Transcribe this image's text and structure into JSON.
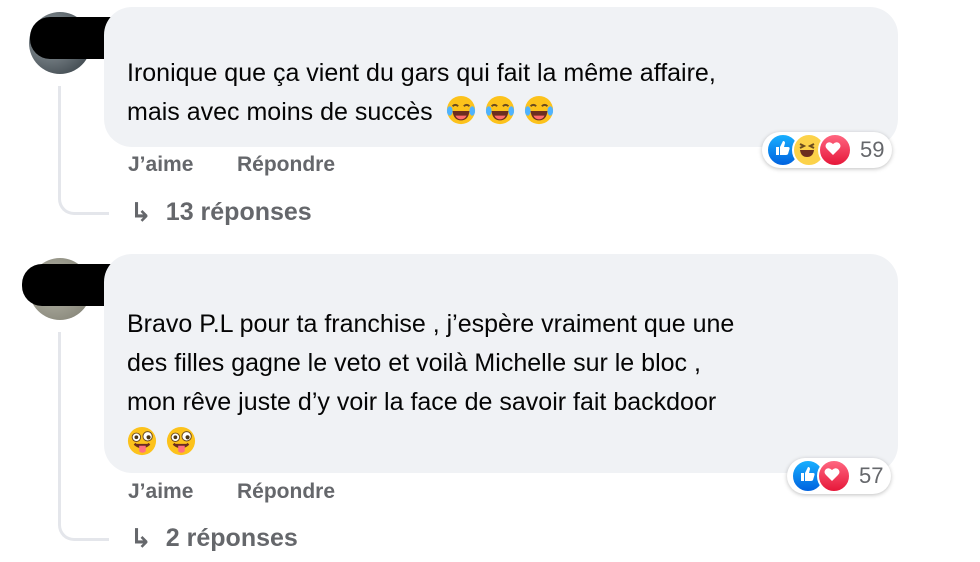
{
  "comments": [
    {
      "text_lines": [
        "Ironique que ça vient du gars qui fait la même affaire,",
        "mais avec moins de succès"
      ],
      "emojis": [
        "laughing-tears",
        "laughing-tears",
        "laughing-tears"
      ],
      "like_label": "J’aime",
      "reply_label": "Répondre",
      "replies_label": "13 réponses",
      "reaction_count": "59",
      "reactions": [
        "like",
        "haha",
        "love"
      ]
    },
    {
      "text_lines": [
        "Bravo P.L pour ta franchise , j’espère vraiment que une",
        "des filles gagne le veto et voilà Michelle sur le bloc ,",
        "mon rêve juste d’y voir la face de savoir fait backdoor"
      ],
      "emojis": [
        "zany-face",
        "zany-face"
      ],
      "like_label": "J’aime",
      "reply_label": "Répondre",
      "replies_label": "2 réponses",
      "reaction_count": "57",
      "reactions": [
        "like",
        "love"
      ]
    }
  ],
  "colors": {
    "bubble": "#f0f2f5",
    "secondary_text": "#65676b",
    "like": "#1877f2",
    "love": "#f33e58",
    "haha": "#f7b125"
  }
}
